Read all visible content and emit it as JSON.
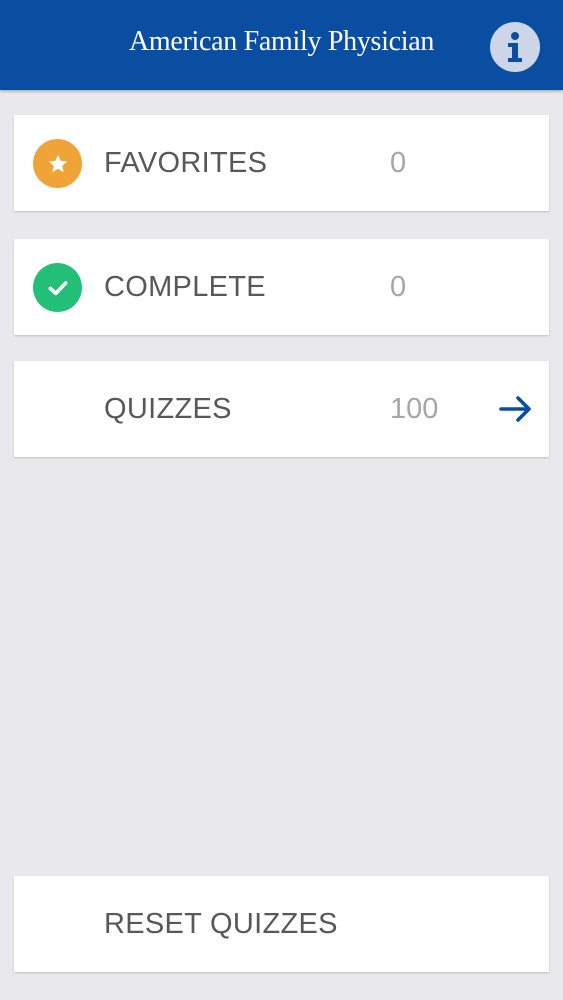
{
  "header": {
    "title": "American Family Physician",
    "info_icon": "info-icon",
    "info_glyph": "i"
  },
  "colors": {
    "header_bg": "#0a4ea1",
    "favorites_badge": "#f0a336",
    "complete_badge": "#23bf77",
    "arrow": "#0a4ea1"
  },
  "menu": {
    "favorites": {
      "label": "FAVORITES",
      "count": "0",
      "icon": "star-icon"
    },
    "complete": {
      "label": "COMPLETE",
      "count": "0",
      "icon": "checkmark-icon"
    },
    "quizzes": {
      "label": "QUIZZES",
      "count": "100",
      "icon": "arrow-right-icon"
    }
  },
  "reset": {
    "label": "RESET QUIZZES"
  }
}
